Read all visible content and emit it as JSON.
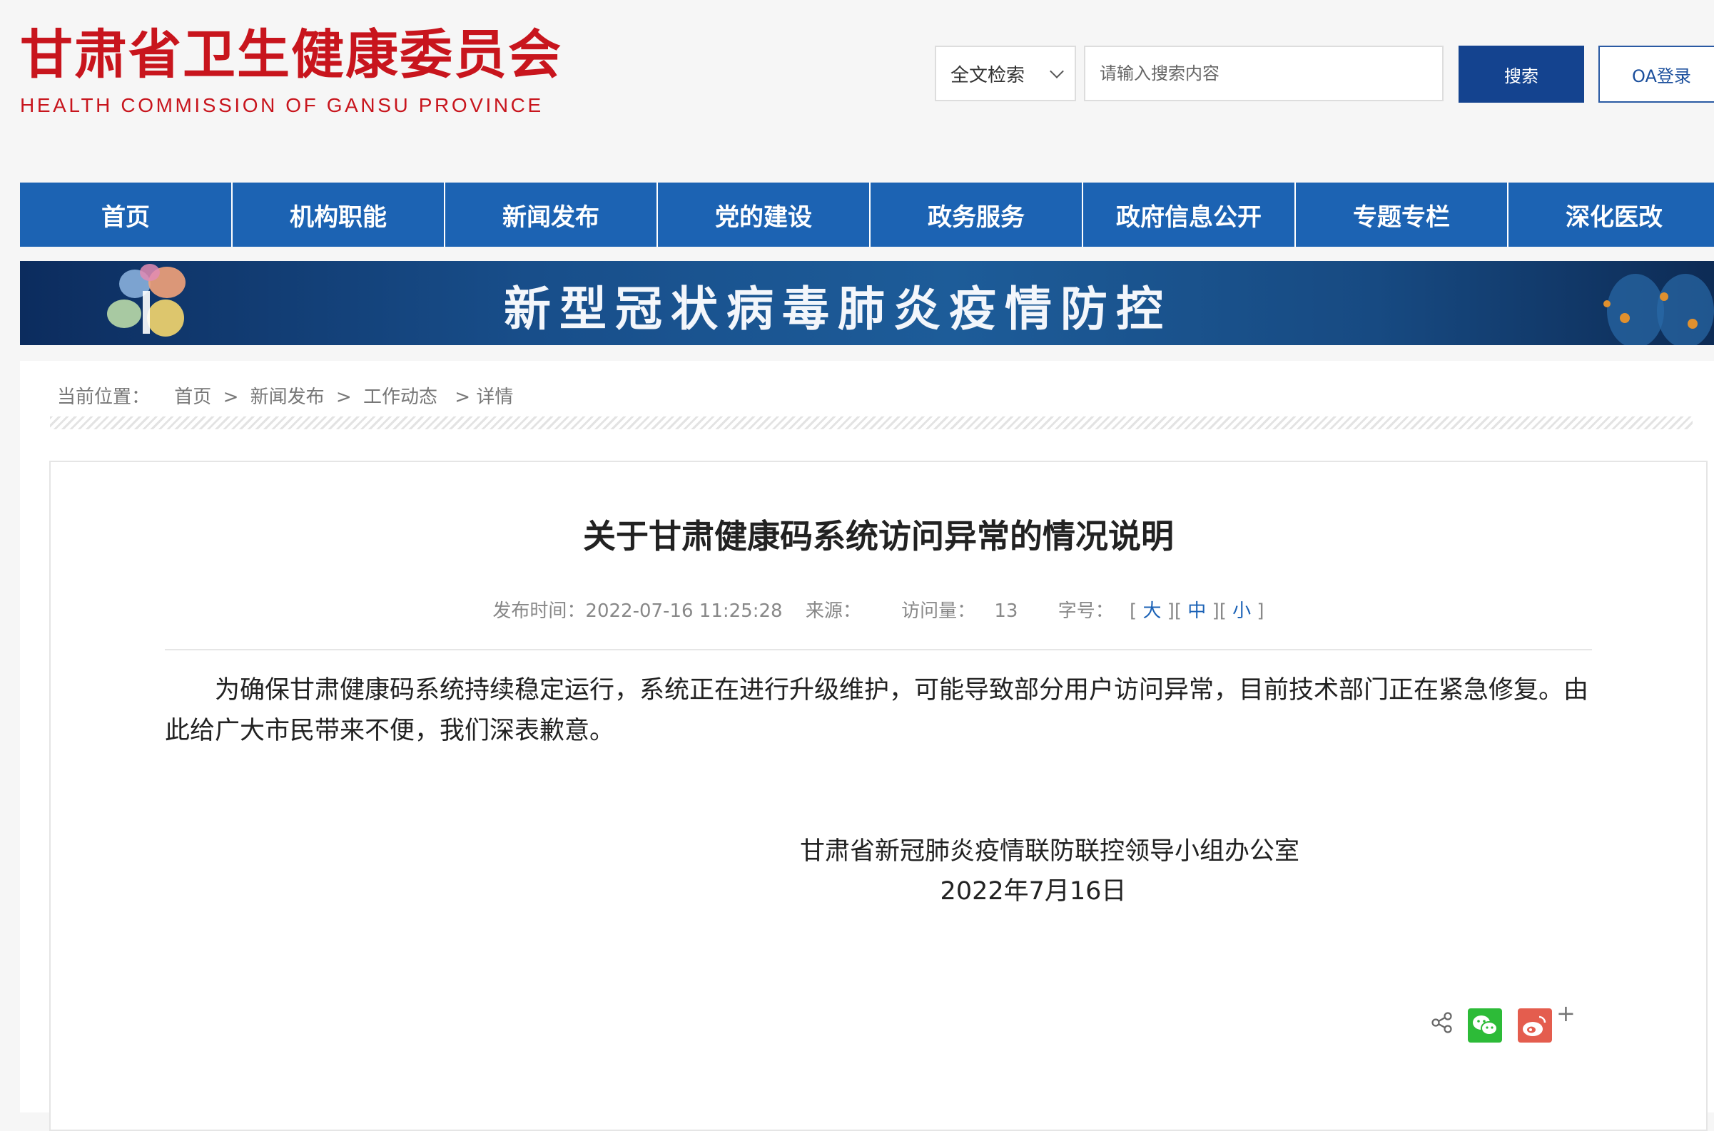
{
  "header": {
    "logo_cn": "甘肃省卫生健康委员会",
    "logo_en": "HEALTH  COMMISSION  OF  GANSU  PROVINCE",
    "search_scope": "全文检索",
    "search_placeholder": "请输入搜索内容",
    "search_button": "搜索",
    "oa_button": "OA登录"
  },
  "nav": {
    "items": [
      {
        "label": "首页"
      },
      {
        "label": "机构职能"
      },
      {
        "label": "新闻发布"
      },
      {
        "label": "党的建设"
      },
      {
        "label": "政务服务"
      },
      {
        "label": "政府信息公开"
      },
      {
        "label": "专题专栏"
      },
      {
        "label": "深化医改"
      }
    ]
  },
  "banner": {
    "title": "新型冠状病毒肺炎疫情防控"
  },
  "breadcrumb": {
    "label": "当前位置：",
    "items": [
      "首页",
      "新闻发布",
      "工作动态"
    ],
    "current": "详情",
    "sep": ">"
  },
  "article": {
    "title": "关于甘肃健康码系统访问异常的情况说明",
    "meta": {
      "publish_label": "发布时间：",
      "publish_time": "2022-07-16 11:25:28",
      "source_label": "来源：",
      "views_label": "访问量：",
      "views": "13",
      "font_label": "字号：",
      "font_large": "大",
      "font_medium": "中",
      "font_small": "小"
    },
    "body": "为确保甘肃健康码系统持续稳定运行，系统正在进行升级维护，可能导致部分用户访问异常，目前技术部门正在紧急修复。由此给广大市民带来不便，我们深表歉意。",
    "signature_org": "甘肃省新冠肺炎疫情联防联控领导小组办公室",
    "signature_date": "2022年7月16日"
  },
  "share": {
    "more": "+"
  },
  "colors": {
    "brand_red": "#c8151d",
    "nav_blue": "#1c63b3",
    "button_blue": "#14438f",
    "wechat_green": "#2dbb38",
    "weibo_red": "#e45d4e"
  }
}
